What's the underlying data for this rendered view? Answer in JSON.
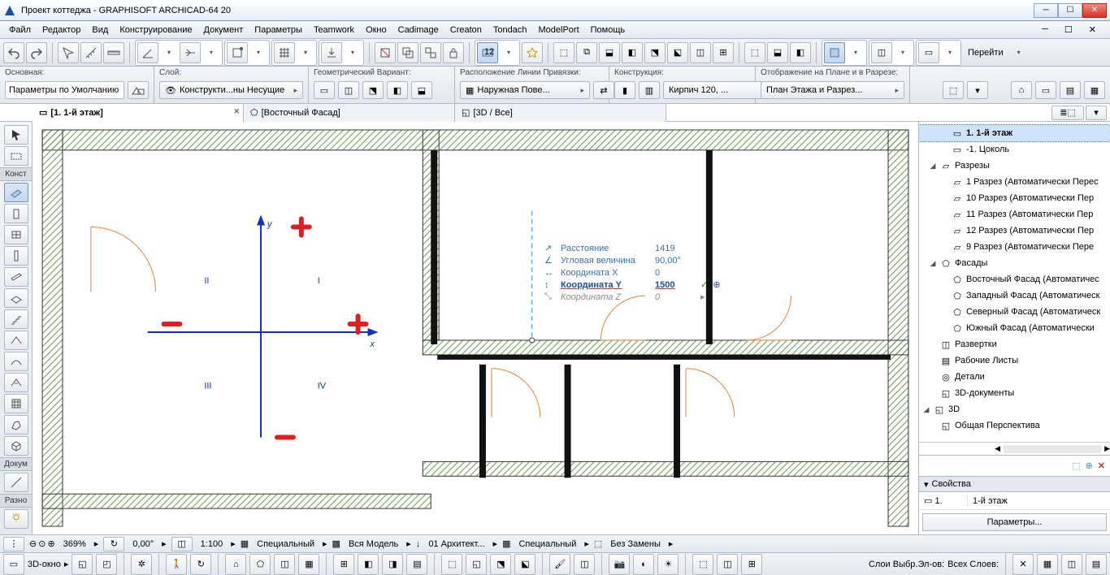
{
  "title": "Проект коттеджа - GRAPHISOFT ARCHICAD-64 20",
  "menu": [
    "Файл",
    "Редактор",
    "Вид",
    "Конструирование",
    "Документ",
    "Параметры",
    "Teamwork",
    "Окно",
    "Cadimage",
    "Creaton",
    "Tondach",
    "ModelPort",
    "Помощь"
  ],
  "go_label": "Перейти",
  "opt": {
    "main_lbl": "Основная:",
    "main_val": "Параметры по Умолчанию",
    "layer_lbl": "Слой:",
    "layer_val": "Конструкти...ны Несущие",
    "geom_lbl": "Геометрический Вариант:",
    "line_lbl": "Расположение Линии Привязки:",
    "line_val": "Наружная Пове...",
    "constr_lbl": "Конструкция:",
    "constr_val": "Кирпич 120, ...",
    "display_lbl": "Отображение на Плане и в Разрезе:",
    "display_val": "План Этажа и Разрез..."
  },
  "tabs": {
    "t1": "[1. 1-й этаж]",
    "t2": "[Восточный Фасад]",
    "t3": "[3D / Все]"
  },
  "toolbox": {
    "group1": "Конст",
    "group2": "Докум",
    "group3": "Разно"
  },
  "tracker": {
    "dist_lbl": "Расстояние",
    "dist_val": "1419",
    "ang_lbl": "Угловая величина",
    "ang_val": "90,00°",
    "x_lbl": "Координата X",
    "x_val": "0",
    "y_lbl": "Координата Y",
    "y_val": "1500",
    "z_lbl": "Координата Z",
    "z_val": "0"
  },
  "quadrants": {
    "q1": "I",
    "q2": "II",
    "q3": "III",
    "q4": "IV",
    "x_axis": "x",
    "y_axis": "y"
  },
  "tree": {
    "floor1": "1. 1-й этаж",
    "floor_b": "-1. Цоколь",
    "sections": "Разрезы",
    "sec1": "1 Разрез (Автоматически Перес",
    "sec10": "10 Разрез (Автоматически Пер",
    "sec11": "11 Разрез (Автоматически Пер",
    "sec12": "12 Разрез (Автоматически Пер",
    "sec9": "9 Разрез (Автоматически Пере",
    "elev": "Фасады",
    "elev_e": "Восточный Фасад (Автоматичес",
    "elev_w": "Западный Фасад (Автоматическ",
    "elev_n": "Северный Фасад (Автоматическ",
    "elev_s": "Южный Фасад (Автоматически",
    "unfold": "Развертки",
    "sheets": "Рабочие Листы",
    "details": "Детали",
    "docs3d": "3D-документы",
    "view3d": "3D",
    "persp": "Общая Перспектива"
  },
  "props": {
    "hdr": "Свойства",
    "r1": "1.",
    "r1v": "1-й этаж",
    "btn": "Параметры..."
  },
  "status": {
    "zoom": "369%",
    "rot": "0,00°",
    "scale": "1:100",
    "s1": "Специальный",
    "s2": "Вся Модель",
    "s3": "01 Архитект...",
    "s4": "Специальный",
    "s5": "Без Замены"
  },
  "bottom": {
    "win3d": "3D-окно",
    "layers1": "Слои Выбр.Эл-ов:",
    "layers2": "Всех Слоев:"
  }
}
